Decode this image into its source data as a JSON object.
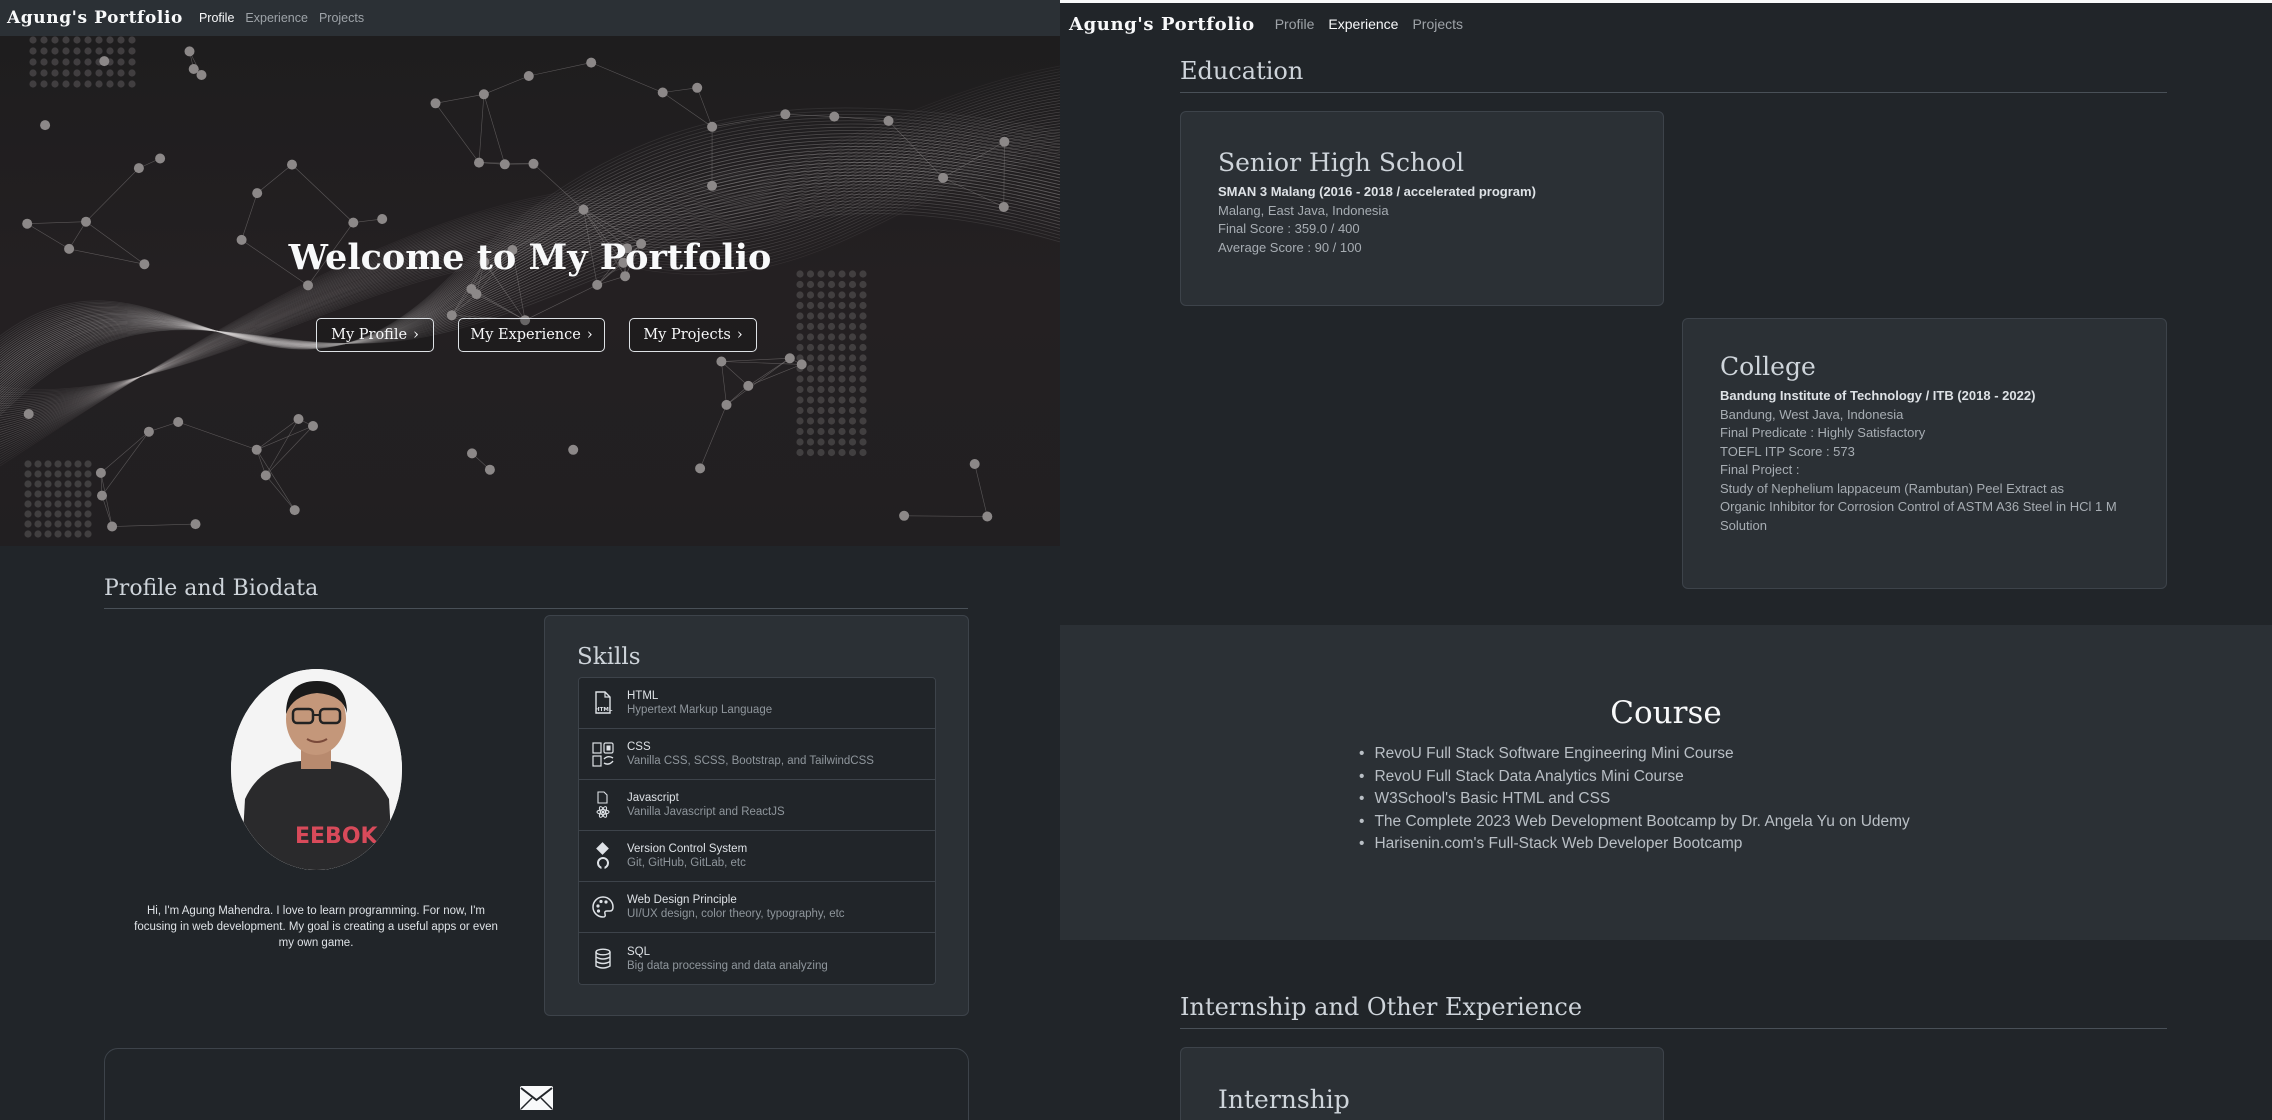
{
  "left": {
    "navbar": {
      "brand": "Agung's Portfolio",
      "links": [
        "Profile",
        "Experience",
        "Projects"
      ],
      "active": "Profile"
    },
    "hero": {
      "title": "Welcome to My Portfolio",
      "buttons": [
        "My Profile",
        "My Experience",
        "My Projects"
      ]
    },
    "profile": {
      "heading": "Profile and Biodata",
      "bio": "Hi, I'm Agung Mahendra. I love to learn programming. For now, I'm focusing in web development. My goal is creating a useful apps or even my own game.",
      "shirt_text": "EEBOK"
    },
    "skills": {
      "heading": "Skills",
      "items": [
        {
          "name": "HTML",
          "desc": "Hypertext Markup Language",
          "icon": "html-file-icon"
        },
        {
          "name": "CSS",
          "desc": "Vanilla CSS, SCSS, Bootstrap, and TailwindCSS",
          "icon": "css-files-icon"
        },
        {
          "name": "Javascript",
          "desc": "Vanilla Javascript and ReactJS",
          "icon": "javascript-react-icon"
        },
        {
          "name": "Version Control System",
          "desc": "Git, GitHub, GitLab, etc",
          "icon": "git-github-icon"
        },
        {
          "name": "Web Design Principle",
          "desc": "UI/UX design, color theory, typography, etc",
          "icon": "palette-icon"
        },
        {
          "name": "SQL",
          "desc": "Big data processing and data analyzing",
          "icon": "database-icon"
        }
      ]
    },
    "contact": {
      "icon": "envelope-icon"
    }
  },
  "right": {
    "navbar": {
      "brand": "Agung's Portfolio",
      "links": [
        "Profile",
        "Experience",
        "Projects"
      ],
      "active": "Experience"
    },
    "education": {
      "heading": "Education",
      "senior": {
        "title": "Senior High School",
        "school": "SMAN 3 Malang (2016 - 2018 / accelerated program)",
        "location": "Malang, East Java, Indonesia",
        "final_score": "Final Score : 359.0 / 400",
        "average_score": "Average Score : 90 / 100"
      },
      "college": {
        "title": "College",
        "school": "Bandung Institute of Technology / ITB (2018 - 2022)",
        "location": "Bandung, West Java, Indonesia",
        "predicate": "Final Predicate : Highly Satisfactory",
        "toefl": "TOEFL ITP Score : 573",
        "project_label": "Final Project :",
        "project_lines": [
          "Study of Nephelium lappaceum (Rambutan) Peel Extract as",
          "Organic Inhibitor for Corrosion Control of ASTM A36 Steel in HCl 1 M",
          "Solution"
        ]
      }
    },
    "course": {
      "heading": "Course",
      "items": [
        "RevoU Full Stack Software Engineering Mini Course",
        "RevoU Full Stack Data Analytics Mini Course",
        "W3School's Basic HTML and CSS",
        "The Complete 2023 Web Development Bootcamp by Dr. Angela Yu on Udemy",
        "Harisenin.com's Full-Stack Web Developer Bootcamp"
      ]
    },
    "internship": {
      "heading": "Internship and Other Experience",
      "card_title": "Internship"
    }
  }
}
